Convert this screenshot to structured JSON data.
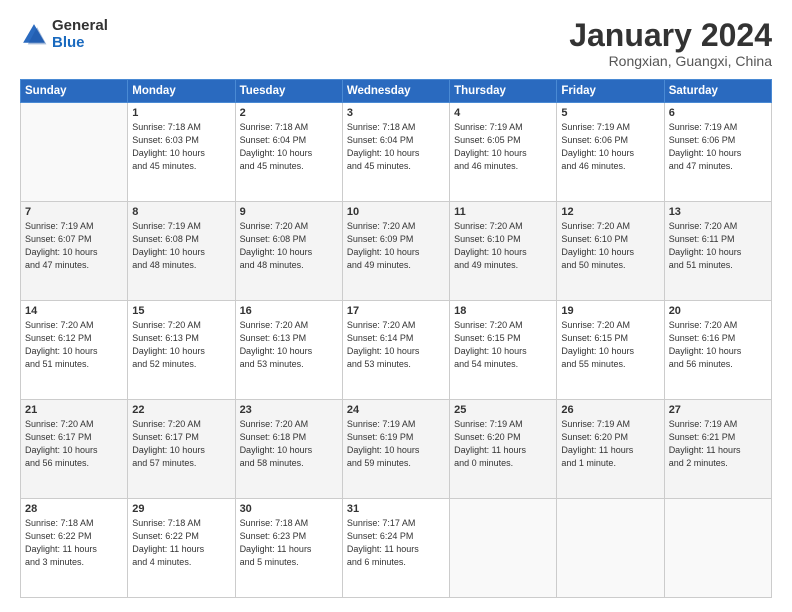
{
  "header": {
    "logo_general": "General",
    "logo_blue": "Blue",
    "month_title": "January 2024",
    "location": "Rongxian, Guangxi, China"
  },
  "weekdays": [
    "Sunday",
    "Monday",
    "Tuesday",
    "Wednesday",
    "Thursday",
    "Friday",
    "Saturday"
  ],
  "weeks": [
    [
      {
        "day": "",
        "detail": ""
      },
      {
        "day": "1",
        "detail": "Sunrise: 7:18 AM\nSunset: 6:03 PM\nDaylight: 10 hours\nand 45 minutes."
      },
      {
        "day": "2",
        "detail": "Sunrise: 7:18 AM\nSunset: 6:04 PM\nDaylight: 10 hours\nand 45 minutes."
      },
      {
        "day": "3",
        "detail": "Sunrise: 7:18 AM\nSunset: 6:04 PM\nDaylight: 10 hours\nand 45 minutes."
      },
      {
        "day": "4",
        "detail": "Sunrise: 7:19 AM\nSunset: 6:05 PM\nDaylight: 10 hours\nand 46 minutes."
      },
      {
        "day": "5",
        "detail": "Sunrise: 7:19 AM\nSunset: 6:06 PM\nDaylight: 10 hours\nand 46 minutes."
      },
      {
        "day": "6",
        "detail": "Sunrise: 7:19 AM\nSunset: 6:06 PM\nDaylight: 10 hours\nand 47 minutes."
      }
    ],
    [
      {
        "day": "7",
        "detail": "Sunrise: 7:19 AM\nSunset: 6:07 PM\nDaylight: 10 hours\nand 47 minutes."
      },
      {
        "day": "8",
        "detail": "Sunrise: 7:19 AM\nSunset: 6:08 PM\nDaylight: 10 hours\nand 48 minutes."
      },
      {
        "day": "9",
        "detail": "Sunrise: 7:20 AM\nSunset: 6:08 PM\nDaylight: 10 hours\nand 48 minutes."
      },
      {
        "day": "10",
        "detail": "Sunrise: 7:20 AM\nSunset: 6:09 PM\nDaylight: 10 hours\nand 49 minutes."
      },
      {
        "day": "11",
        "detail": "Sunrise: 7:20 AM\nSunset: 6:10 PM\nDaylight: 10 hours\nand 49 minutes."
      },
      {
        "day": "12",
        "detail": "Sunrise: 7:20 AM\nSunset: 6:10 PM\nDaylight: 10 hours\nand 50 minutes."
      },
      {
        "day": "13",
        "detail": "Sunrise: 7:20 AM\nSunset: 6:11 PM\nDaylight: 10 hours\nand 51 minutes."
      }
    ],
    [
      {
        "day": "14",
        "detail": "Sunrise: 7:20 AM\nSunset: 6:12 PM\nDaylight: 10 hours\nand 51 minutes."
      },
      {
        "day": "15",
        "detail": "Sunrise: 7:20 AM\nSunset: 6:13 PM\nDaylight: 10 hours\nand 52 minutes."
      },
      {
        "day": "16",
        "detail": "Sunrise: 7:20 AM\nSunset: 6:13 PM\nDaylight: 10 hours\nand 53 minutes."
      },
      {
        "day": "17",
        "detail": "Sunrise: 7:20 AM\nSunset: 6:14 PM\nDaylight: 10 hours\nand 53 minutes."
      },
      {
        "day": "18",
        "detail": "Sunrise: 7:20 AM\nSunset: 6:15 PM\nDaylight: 10 hours\nand 54 minutes."
      },
      {
        "day": "19",
        "detail": "Sunrise: 7:20 AM\nSunset: 6:15 PM\nDaylight: 10 hours\nand 55 minutes."
      },
      {
        "day": "20",
        "detail": "Sunrise: 7:20 AM\nSunset: 6:16 PM\nDaylight: 10 hours\nand 56 minutes."
      }
    ],
    [
      {
        "day": "21",
        "detail": "Sunrise: 7:20 AM\nSunset: 6:17 PM\nDaylight: 10 hours\nand 56 minutes."
      },
      {
        "day": "22",
        "detail": "Sunrise: 7:20 AM\nSunset: 6:17 PM\nDaylight: 10 hours\nand 57 minutes."
      },
      {
        "day": "23",
        "detail": "Sunrise: 7:20 AM\nSunset: 6:18 PM\nDaylight: 10 hours\nand 58 minutes."
      },
      {
        "day": "24",
        "detail": "Sunrise: 7:19 AM\nSunset: 6:19 PM\nDaylight: 10 hours\nand 59 minutes."
      },
      {
        "day": "25",
        "detail": "Sunrise: 7:19 AM\nSunset: 6:20 PM\nDaylight: 11 hours\nand 0 minutes."
      },
      {
        "day": "26",
        "detail": "Sunrise: 7:19 AM\nSunset: 6:20 PM\nDaylight: 11 hours\nand 1 minute."
      },
      {
        "day": "27",
        "detail": "Sunrise: 7:19 AM\nSunset: 6:21 PM\nDaylight: 11 hours\nand 2 minutes."
      }
    ],
    [
      {
        "day": "28",
        "detail": "Sunrise: 7:18 AM\nSunset: 6:22 PM\nDaylight: 11 hours\nand 3 minutes."
      },
      {
        "day": "29",
        "detail": "Sunrise: 7:18 AM\nSunset: 6:22 PM\nDaylight: 11 hours\nand 4 minutes."
      },
      {
        "day": "30",
        "detail": "Sunrise: 7:18 AM\nSunset: 6:23 PM\nDaylight: 11 hours\nand 5 minutes."
      },
      {
        "day": "31",
        "detail": "Sunrise: 7:17 AM\nSunset: 6:24 PM\nDaylight: 11 hours\nand 6 minutes."
      },
      {
        "day": "",
        "detail": ""
      },
      {
        "day": "",
        "detail": ""
      },
      {
        "day": "",
        "detail": ""
      }
    ]
  ]
}
